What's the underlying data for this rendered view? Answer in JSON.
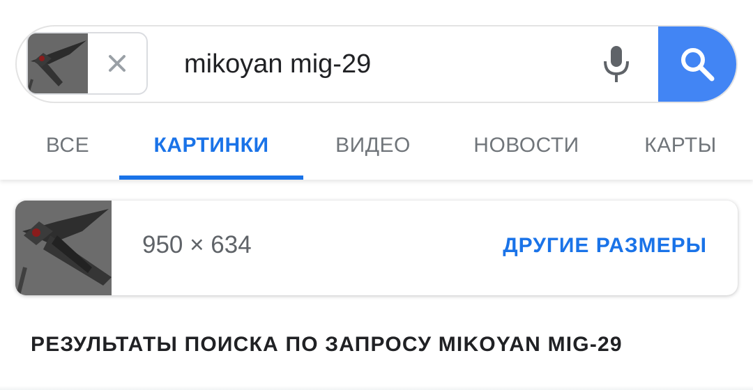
{
  "search": {
    "query": "mikoyan mig-29",
    "image_chip_icon": "aircraft-thumbnail",
    "remove_icon": "close-icon",
    "voice_icon": "mic-icon",
    "search_icon": "search-icon"
  },
  "tabs": [
    {
      "label": "ВСЕ",
      "active": false
    },
    {
      "label": "КАРТИНКИ",
      "active": true
    },
    {
      "label": "ВИДЕО",
      "active": false
    },
    {
      "label": "НОВОСТИ",
      "active": false
    },
    {
      "label": "КАРТЫ",
      "active": false
    }
  ],
  "image_card": {
    "dimensions": "950 × 634",
    "other_sizes_label": "ДРУГИЕ РАЗМЕРЫ"
  },
  "results": {
    "heading": "РЕЗУЛЬТАТЫ ПОИСКА ПО ЗАПРОСУ MIKOYAN MIG-29"
  },
  "colors": {
    "accent": "#1a73e8",
    "search_button": "#4285f4",
    "tab_inactive": "#70757a",
    "text": "#202124"
  }
}
